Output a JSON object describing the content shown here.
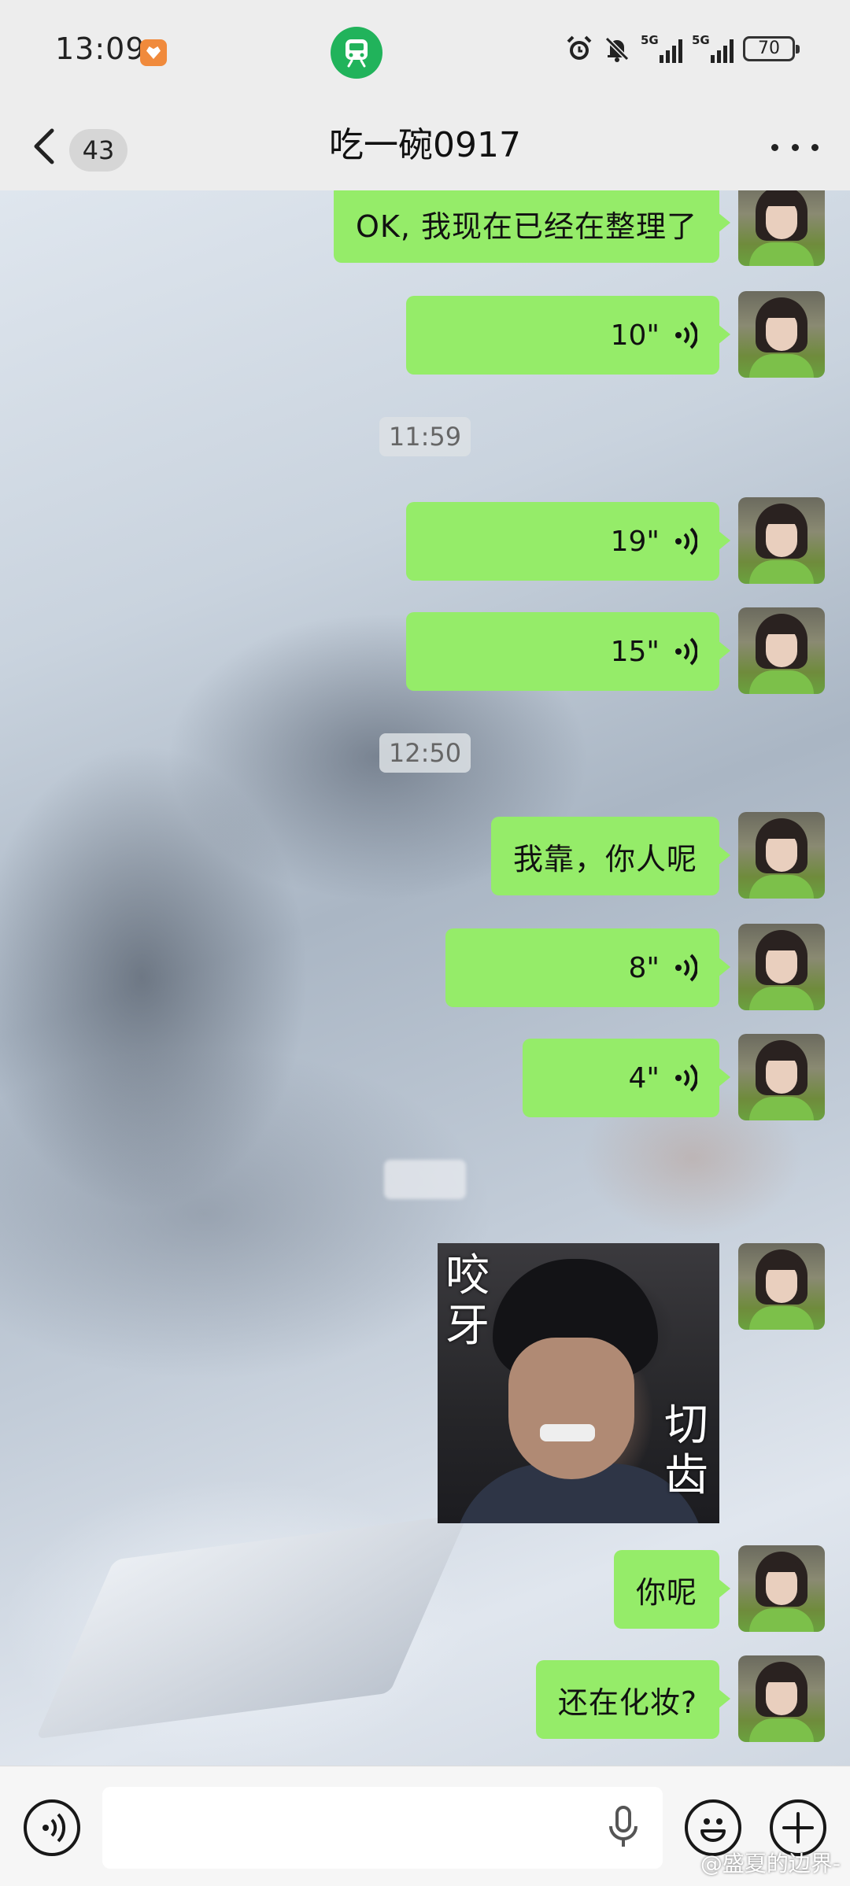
{
  "status_bar": {
    "time": "13:09",
    "signal_1_label": "5G",
    "signal_2_label": "5G",
    "battery": "70"
  },
  "nav": {
    "unread_count": "43",
    "title": "吃一碗0917"
  },
  "messages": [
    {
      "type": "text",
      "text": "OK, 我现在已经在整理了"
    },
    {
      "type": "voice",
      "duration": "10\""
    },
    {
      "type": "time",
      "text": "11:59"
    },
    {
      "type": "voice",
      "duration": "19\""
    },
    {
      "type": "voice",
      "duration": "15\""
    },
    {
      "type": "time",
      "text": "12:50"
    },
    {
      "type": "text",
      "text": "我靠，你人呢"
    },
    {
      "type": "voice",
      "duration": "8\""
    },
    {
      "type": "voice",
      "duration": "4\""
    },
    {
      "type": "sticker",
      "caption_left": "咬牙",
      "caption_right": "切齿"
    },
    {
      "type": "text",
      "text": "你呢"
    },
    {
      "type": "text",
      "text": "还在化妆?"
    }
  ],
  "watermark": "@盛夏的边界-",
  "colors": {
    "bubble": "#95ec69",
    "accent_green": "#21b35b",
    "background": "#ededed"
  },
  "icons": [
    "back-arrow-icon",
    "more-icon",
    "voice-icon",
    "mic-icon",
    "emoji-icon",
    "plus-icon",
    "train-icon",
    "alarm-icon",
    "mute-icon"
  ]
}
